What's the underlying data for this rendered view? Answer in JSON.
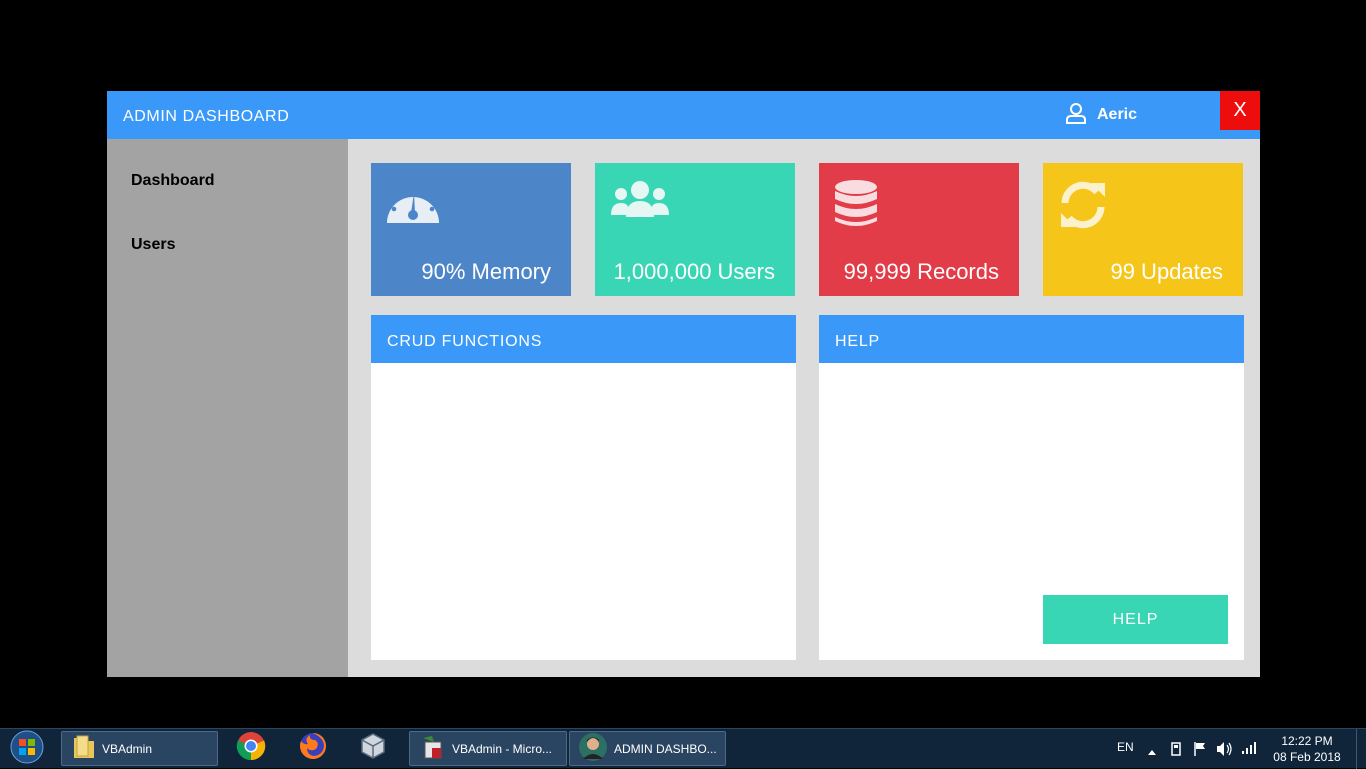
{
  "window": {
    "title": "ADMIN DASHBOARD",
    "user_name": "Aeric",
    "close_label": "X"
  },
  "sidebar": {
    "items": [
      {
        "label": "Dashboard"
      },
      {
        "label": "Users"
      }
    ]
  },
  "tiles": [
    {
      "label": "90% Memory",
      "icon": "gauge-icon",
      "color": "#4d86c8"
    },
    {
      "label": "1,000,000 Users",
      "icon": "users-icon",
      "color": "#39d6b6"
    },
    {
      "label": "99,999 Records",
      "icon": "database-icon",
      "color": "#e23c48"
    },
    {
      "label": "99 Updates",
      "icon": "refresh-icon",
      "color": "#f5c619"
    }
  ],
  "panels": {
    "crud": {
      "title": "CRUD FUNCTIONS"
    },
    "help": {
      "title": "HELP",
      "button_label": "HELP"
    }
  },
  "taskbar": {
    "items": [
      {
        "label": "VBAdmin",
        "icon": "folder-icon"
      },
      {
        "label": "VBAdmin - Micro...",
        "icon": "visual-basic-icon"
      },
      {
        "label": "ADMIN DASHBO...",
        "icon": "app-avatar-icon"
      }
    ],
    "pinned": [
      "chrome-icon",
      "firefox-icon",
      "virtualbox-icon"
    ],
    "language": "EN",
    "time": "12:22 PM",
    "date": "08 Feb 2018"
  },
  "colors": {
    "header_blue": "#3a99f8",
    "close_red": "#ee0d0d",
    "sidebar_gray": "#a3a3a3",
    "teal": "#39d6b6"
  }
}
